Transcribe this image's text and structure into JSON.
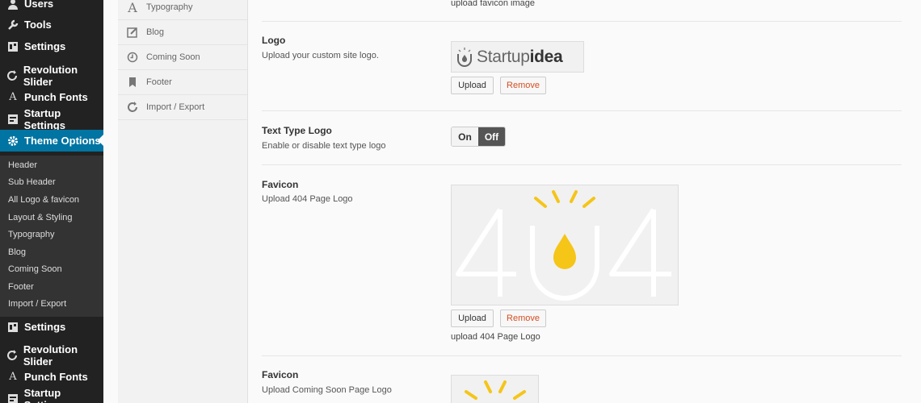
{
  "wp_menu": {
    "items": [
      {
        "label": "Users",
        "icon": "users-icon"
      },
      {
        "label": "Tools",
        "icon": "tools-icon"
      },
      {
        "label": "Settings",
        "icon": "settings-icon"
      },
      {
        "label": "Revolution Slider",
        "icon": "refresh-icon"
      },
      {
        "label": "Punch Fonts",
        "icon": "font-icon"
      },
      {
        "label": "Startup Settings",
        "icon": "settings-icon"
      },
      {
        "label": "Theme Options",
        "icon": "gear-icon"
      },
      {
        "label": "Settings",
        "icon": "settings-icon"
      },
      {
        "label": "Revolution Slider",
        "icon": "refresh-icon"
      },
      {
        "label": "Punch Fonts",
        "icon": "font-icon"
      },
      {
        "label": "Startup Settings",
        "icon": "settings-icon"
      }
    ],
    "submenu": [
      "Header",
      "Sub Header",
      "All Logo & favicon",
      "Layout & Styling",
      "Typography",
      "Blog",
      "Coming Soon",
      "Footer",
      "Import / Export"
    ]
  },
  "panel_nav": {
    "items": [
      {
        "label": "Typography",
        "icon": "typography-icon"
      },
      {
        "label": "Blog",
        "icon": "edit-icon"
      },
      {
        "label": "Coming Soon",
        "icon": "clock-icon"
      },
      {
        "label": "Footer",
        "icon": "bookmark-icon"
      },
      {
        "label": "Import / Export",
        "icon": "refresh-icon"
      }
    ]
  },
  "content": {
    "top_note": "upload favicon image",
    "logo": {
      "title": "Logo",
      "desc": "Upload your custom site logo.",
      "image_text_a": "Startup",
      "image_text_b": "idea",
      "upload_label": "Upload",
      "remove_label": "Remove"
    },
    "text_type_logo": {
      "title": "Text Type Logo",
      "desc": "Enable or disable text type logo",
      "on_label": "On",
      "off_label": "Off",
      "state": "off"
    },
    "favicon_404": {
      "title": "Favicon",
      "desc": "Upload 404 Page Logo",
      "upload_label": "Upload",
      "remove_label": "Remove",
      "note": "upload 404 Page Logo"
    },
    "favicon_coming": {
      "title": "Favicon",
      "desc": "Upload Coming Soon Page Logo"
    }
  },
  "colors": {
    "accent": "#0074a2",
    "bulb_yellow": "#f5c518",
    "remove_red": "#d54e21"
  }
}
